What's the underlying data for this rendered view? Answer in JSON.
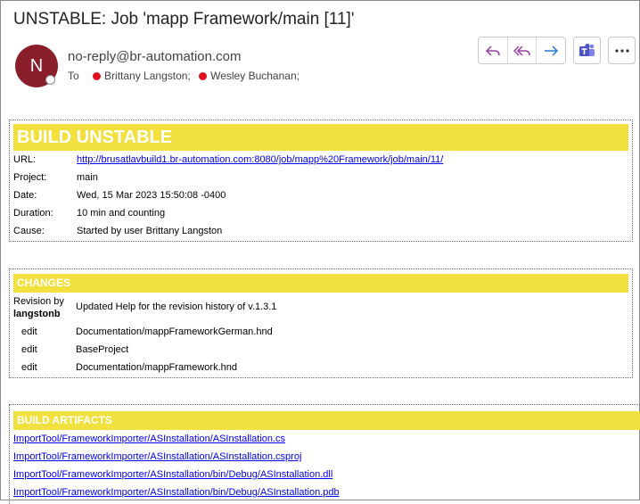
{
  "email": {
    "subject": "UNSTABLE: Job 'mapp Framework/main [11]'",
    "avatar_initial": "N",
    "sender": "no-reply@br-automation.com",
    "to_label": "To",
    "recipients": [
      "Brittany Langston;",
      "Wesley Buchanan;"
    ],
    "toolbar": [
      "reply-icon",
      "reply-all-icon",
      "forward-icon",
      "teams-icon",
      "more-icon"
    ]
  },
  "build": {
    "status_title": "BUILD UNSTABLE",
    "fields": [
      {
        "key": "URL:",
        "value": "http://brusatlavbuild1.br-automation.com:8080/job/mapp%20Framework/job/main/11/"
      },
      {
        "key": "Project:",
        "value": "main"
      },
      {
        "key": "Date:",
        "value": "Wed, 15 Mar 2023 15:50:08 -0400"
      },
      {
        "key": "Duration:",
        "value": "10 min and counting"
      },
      {
        "key": "Cause:",
        "value": "Started by user Brittany Langston"
      }
    ]
  },
  "changes": {
    "title": "CHANGES",
    "revision_label": "Revision by",
    "revision_user": "langstonb",
    "message": "Updated Help for the revision history of v.1.3.1",
    "edits": [
      {
        "action": "edit",
        "path": "Documentation/mappFrameworkGerman.hnd"
      },
      {
        "action": "edit",
        "path": "BaseProject"
      },
      {
        "action": "edit",
        "path": "Documentation/mappFramework.hnd"
      }
    ]
  },
  "artifacts": {
    "title": "BUILD ARTIFACTS",
    "items": [
      "ImportTool/FrameworkImporter/ASInstallation/ASInstallation.cs",
      "ImportTool/FrameworkImporter/ASInstallation/ASInstallation.csproj",
      "ImportTool/FrameworkImporter/ASInstallation/bin/Debug/ASInstallation.dll",
      "ImportTool/FrameworkImporter/ASInstallation/bin/Debug/ASInstallation.pdb"
    ]
  },
  "colors": {
    "header_yellow": "#f1e03d",
    "avatar": "#8a1f2b",
    "presence_busy": "#e0141c",
    "link": "#0000ee"
  }
}
